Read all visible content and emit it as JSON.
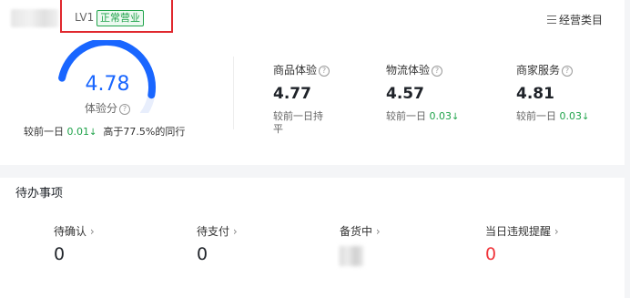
{
  "header": {
    "level": "LV1",
    "status": "正常营业",
    "categories_link": "经营类目"
  },
  "experience": {
    "score": "4.78",
    "score_label": "体验分",
    "gauge_percent": 87,
    "compare_label": "较前一日",
    "compare_value": "0.01",
    "peer_text": "高于77.5%的同行"
  },
  "metrics": [
    {
      "label": "商品体验",
      "value": "4.77",
      "compare_label": "较前一日持平",
      "compare_value": ""
    },
    {
      "label": "物流体验",
      "value": "4.57",
      "compare_label": "较前一日",
      "compare_value": "0.03"
    },
    {
      "label": "商家服务",
      "value": "4.81",
      "compare_label": "较前一日",
      "compare_value": "0.03"
    }
  ],
  "todo": {
    "title": "待办事项",
    "items": [
      {
        "label": "待确认",
        "value": "0"
      },
      {
        "label": "待支付",
        "value": "0"
      },
      {
        "label": "备货中",
        "value": ""
      },
      {
        "label": "当日违规提醒",
        "value": "0"
      }
    ]
  },
  "colors": {
    "accent": "#1966ff",
    "up_down_green": "#1fa34a",
    "alert_red": "#f0353b",
    "highlight_box": "#e0282e"
  }
}
